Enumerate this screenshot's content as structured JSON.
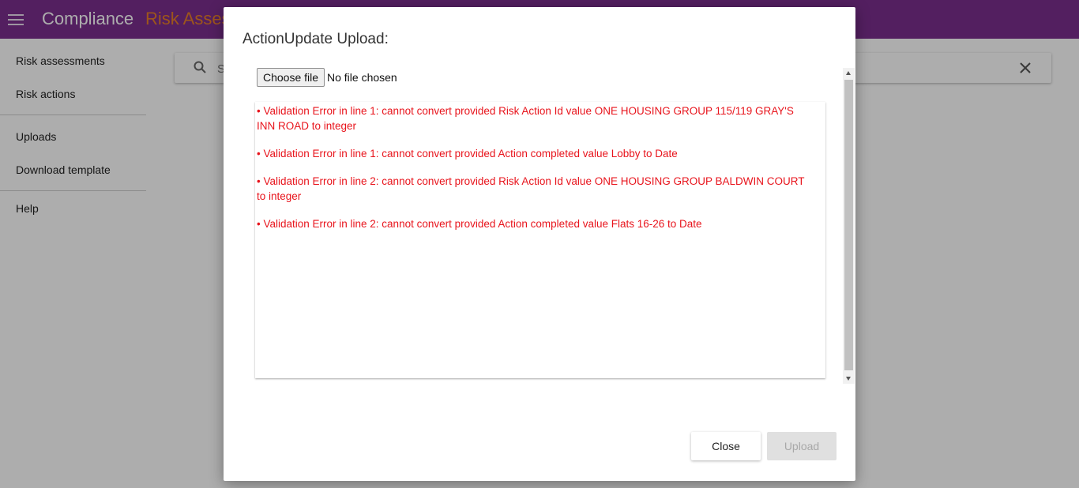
{
  "header": {
    "app_title": "Compliance",
    "section_title": "Risk Assessments",
    "menu_icon": "hamburger-menu-icon",
    "color": "#7b2f8e",
    "section_color": "#e87e28"
  },
  "sidebar": {
    "items": [
      {
        "label": "Risk assessments"
      },
      {
        "label": "Risk actions"
      },
      {
        "label": "Uploads"
      },
      {
        "label": "Download template"
      },
      {
        "label": "Help"
      }
    ]
  },
  "search": {
    "placeholder": "Search",
    "search_icon": "search-icon",
    "clear_icon": "close-icon"
  },
  "dialog": {
    "title": "ActionUpdate Upload:",
    "file_button_label": "Choose file",
    "file_status": "No file chosen",
    "errors": [
      "• Validation Error in line 1: cannot convert provided Risk Action Id value ONE HOUSING GROUP 115/119 GRAY'S INN ROAD to integer",
      "• Validation Error in line 1: cannot convert provided Action completed value Lobby to Date",
      "• Validation Error in line 2: cannot convert provided Risk Action Id value ONE HOUSING GROUP BALDWIN COURT to integer",
      "• Validation Error in line 2: cannot convert provided Action completed value Flats 16-26 to Date"
    ],
    "error_color": "#e8141c",
    "close_label": "Close",
    "upload_label": "Upload",
    "upload_disabled": true
  }
}
